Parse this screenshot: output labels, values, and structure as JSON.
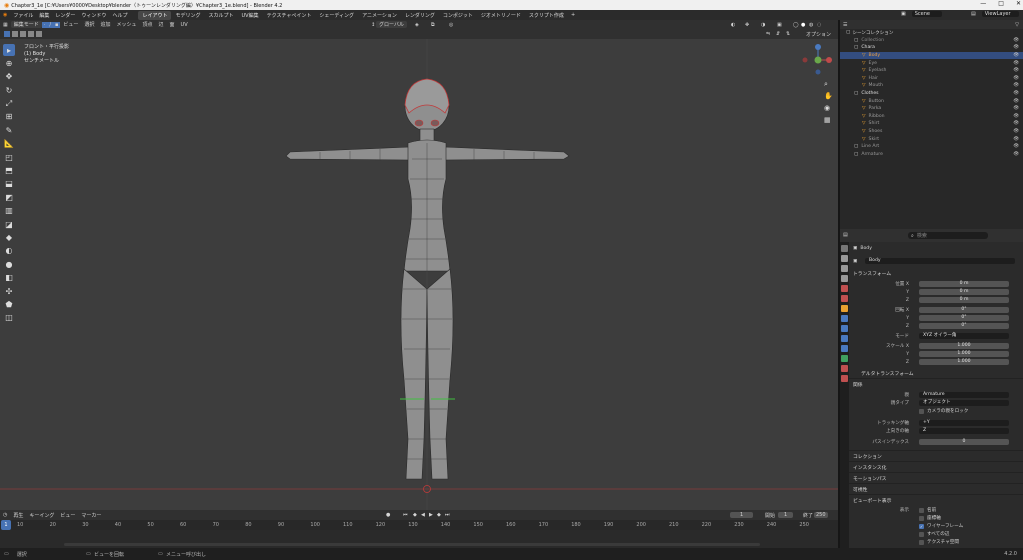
{
  "window": {
    "title": "Chapter3_1e [C:¥Users¥0000¥Desktop¥blender（トゥーンレンダリング編）¥Chapter3_1e.blend] - Blender 4.2",
    "controls": [
      "—",
      "□",
      "✕"
    ]
  },
  "menubar": {
    "items": [
      "ファイル",
      "編集",
      "レンダー",
      "ウィンドウ",
      "ヘルプ"
    ],
    "workspaces": [
      "レイアウト",
      "モデリング",
      "スカルプト",
      "UV編集",
      "テクスチャペイント",
      "シェーディング",
      "アニメーション",
      "レンダリング",
      "コンポジット",
      "ジオメトリノード",
      "スクリプト作成"
    ],
    "active_workspace": "レイアウト",
    "add_tab": "+",
    "scene": "Scene",
    "view_layer": "ViewLayer"
  },
  "viewport_header": {
    "mode": "編集モード",
    "menus": [
      "ビュー",
      "選択",
      "追加",
      "メッシュ",
      "頂点",
      "辺",
      "面",
      "UV"
    ],
    "transform_orientation": "グローバル",
    "options": "オプション"
  },
  "viewport": {
    "view_name": "フロント・平行投影",
    "object_label": "(1) Body",
    "unit_label": "センチメートル"
  },
  "outliner": {
    "search_placeholder": "",
    "root": "シーンコレクション",
    "rows": [
      {
        "name": "Collection",
        "indent": 1,
        "color": "#8a8a8a"
      },
      {
        "name": "Chara",
        "indent": 1,
        "color": "#e0e0e0"
      },
      {
        "name": "Body",
        "indent": 2,
        "color": "#f0a040"
      },
      {
        "name": "Eye",
        "indent": 2,
        "color": "#9a9a9a"
      },
      {
        "name": "Eyelash",
        "indent": 2,
        "color": "#9a9a9a"
      },
      {
        "name": "Hair",
        "indent": 2,
        "color": "#9a9a9a"
      },
      {
        "name": "Mouth",
        "indent": 2,
        "color": "#9a9a9a"
      },
      {
        "name": "Clothes",
        "indent": 1,
        "color": "#e0e0e0"
      },
      {
        "name": "Button",
        "indent": 2,
        "color": "#9a9a9a"
      },
      {
        "name": "Parka",
        "indent": 2,
        "color": "#9a9a9a"
      },
      {
        "name": "Ribbon",
        "indent": 2,
        "color": "#9a9a9a"
      },
      {
        "name": "Shirt",
        "indent": 2,
        "color": "#9a9a9a"
      },
      {
        "name": "Shoes",
        "indent": 2,
        "color": "#9a9a9a"
      },
      {
        "name": "Skirt",
        "indent": 2,
        "color": "#9a9a9a"
      },
      {
        "name": "Line Art",
        "indent": 1,
        "color": "#9a9a9a"
      },
      {
        "name": "Armature",
        "indent": 1,
        "color": "#9a9a9a"
      }
    ]
  },
  "properties": {
    "search_placeholder": "検索",
    "context_object": "Body",
    "object_name": "Body",
    "transform": {
      "title": "トランスフォーム",
      "location_label": "位置 X",
      "location": [
        "0 m",
        "0 m",
        "0 m"
      ],
      "rotation_label": "回転 X",
      "rotation": [
        "0°",
        "0°",
        "0°"
      ],
      "mode_label": "モード",
      "mode": "XYZ オイラー角",
      "scale_label": "スケール X",
      "scale": [
        "1.000",
        "1.000",
        "1.000"
      ],
      "axis_y": "Y",
      "axis_z": "Z"
    },
    "delta_transform": "デルタトランスフォーム",
    "relations": {
      "title": "関係",
      "parent_label": "親",
      "parent": "Armature",
      "parent_type_label": "親タイプ",
      "parent_type": "オブジェクト",
      "camera_lock": "カメラの親をロック",
      "tracking_axis_label": "トラッキング軸",
      "tracking_axis": "+Y",
      "up_axis_label": "上向きの軸",
      "up_axis": "Z",
      "pass_index_label": "パスインデックス",
      "pass_index": "0"
    },
    "collapsed_panels": [
      "コレクション",
      "インスタンス化",
      "モーションパス",
      "可視性"
    ],
    "viewport_display": {
      "title": "ビューポート表示",
      "show_label": "表示",
      "options": [
        {
          "label": "名前",
          "checked": false
        },
        {
          "label": "座標軸",
          "checked": false
        },
        {
          "label": "ワイヤーフレーム",
          "checked": true
        },
        {
          "label": "すべての辺",
          "checked": false
        },
        {
          "label": "テクスチャ空間",
          "checked": false
        }
      ]
    }
  },
  "timeline": {
    "menus": [
      "再生",
      "キーイング",
      "ビュー",
      "マーカー"
    ],
    "current_frame": "1",
    "start_label": "開始",
    "start": "1",
    "end_label": "終了",
    "end": "250",
    "ticks": [
      "10",
      "20",
      "30",
      "40",
      "50",
      "60",
      "70",
      "80",
      "90",
      "100",
      "110",
      "120",
      "130",
      "140",
      "150",
      "160",
      "170",
      "180",
      "190",
      "200",
      "210",
      "220",
      "230",
      "240",
      "250"
    ]
  },
  "statusbar": {
    "select": "選択",
    "rotate_view": "ビューを回転",
    "context_menu": "メニュー呼び出し",
    "version": "4.2.0"
  }
}
